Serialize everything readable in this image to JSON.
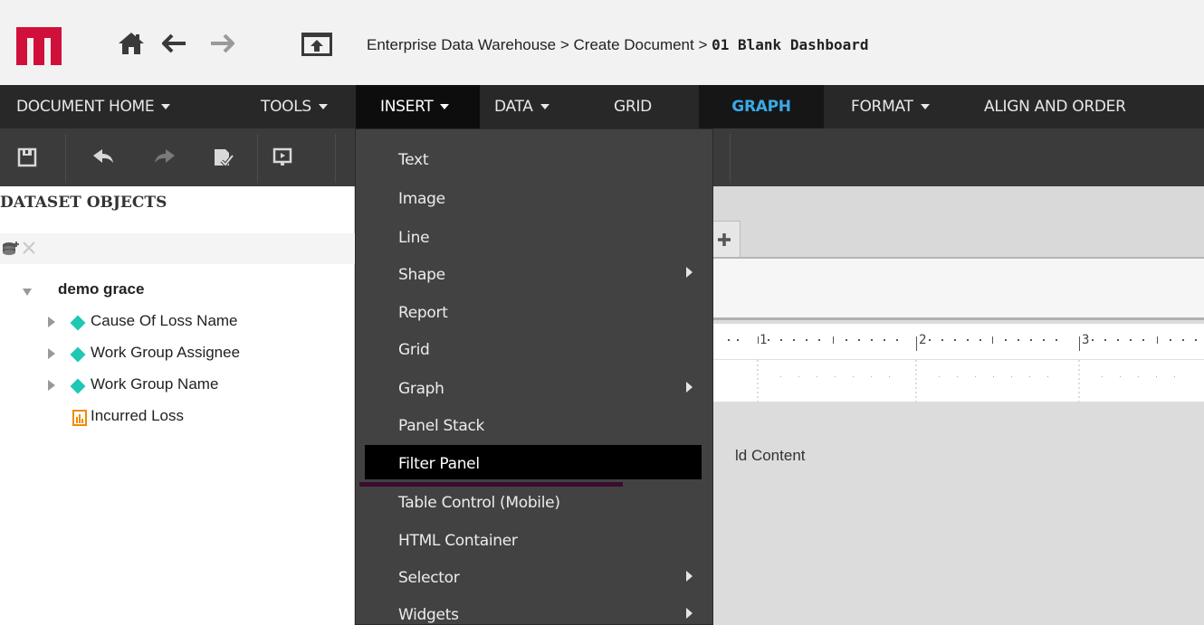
{
  "breadcrumb": {
    "path": "Enterprise Data Warehouse > Create Document > ",
    "current": "01 Blank Dashboard"
  },
  "menubar": {
    "items": [
      {
        "label": "DOCUMENT HOME",
        "dropdown": true
      },
      {
        "label": "TOOLS",
        "dropdown": true
      },
      {
        "label": "INSERT",
        "dropdown": true,
        "active": true
      },
      {
        "label": "DATA",
        "dropdown": true
      },
      {
        "label": "GRID",
        "dropdown": false
      },
      {
        "label": "GRAPH",
        "dropdown": false,
        "highlight": true
      },
      {
        "label": "FORMAT",
        "dropdown": true
      },
      {
        "label": "ALIGN AND ORDER",
        "dropdown": false
      }
    ]
  },
  "toolbar": {
    "icons": [
      "save-icon",
      "undo-icon",
      "redo-icon",
      "validate-icon",
      "present-icon"
    ]
  },
  "dataset": {
    "title": "DATASET OBJECTS",
    "name": "demo grace",
    "attributes": [
      "Cause Of Loss Name",
      "Work Group Assignee",
      "Work Group Name"
    ],
    "metric": "Incurred Loss"
  },
  "insert_menu": {
    "items": [
      {
        "label": "Text",
        "submenu": false
      },
      {
        "label": "Image",
        "submenu": false
      },
      {
        "label": "Line",
        "submenu": false
      },
      {
        "label": "Shape",
        "submenu": true
      },
      {
        "label": "Report",
        "submenu": false
      },
      {
        "label": "Grid",
        "submenu": false
      },
      {
        "label": "Graph",
        "submenu": true
      },
      {
        "label": "Panel Stack",
        "submenu": false
      },
      {
        "label": "Filter Panel",
        "submenu": false,
        "hover": true
      },
      {
        "label": "Table Control (Mobile)",
        "submenu": false
      },
      {
        "label": "HTML Container",
        "submenu": false
      },
      {
        "label": "Selector",
        "submenu": true
      },
      {
        "label": "Widgets",
        "submenu": true
      }
    ]
  },
  "canvas": {
    "ruler_marks": [
      "1",
      "2",
      "3"
    ],
    "placeholder_text": "ld Content"
  },
  "colors": {
    "brand": "#d0103a",
    "menubar_bg": "#282828",
    "graph_accent": "#3aa9e6",
    "attribute_icon": "#1ec8b2",
    "metric_icon": "#f08c00"
  }
}
